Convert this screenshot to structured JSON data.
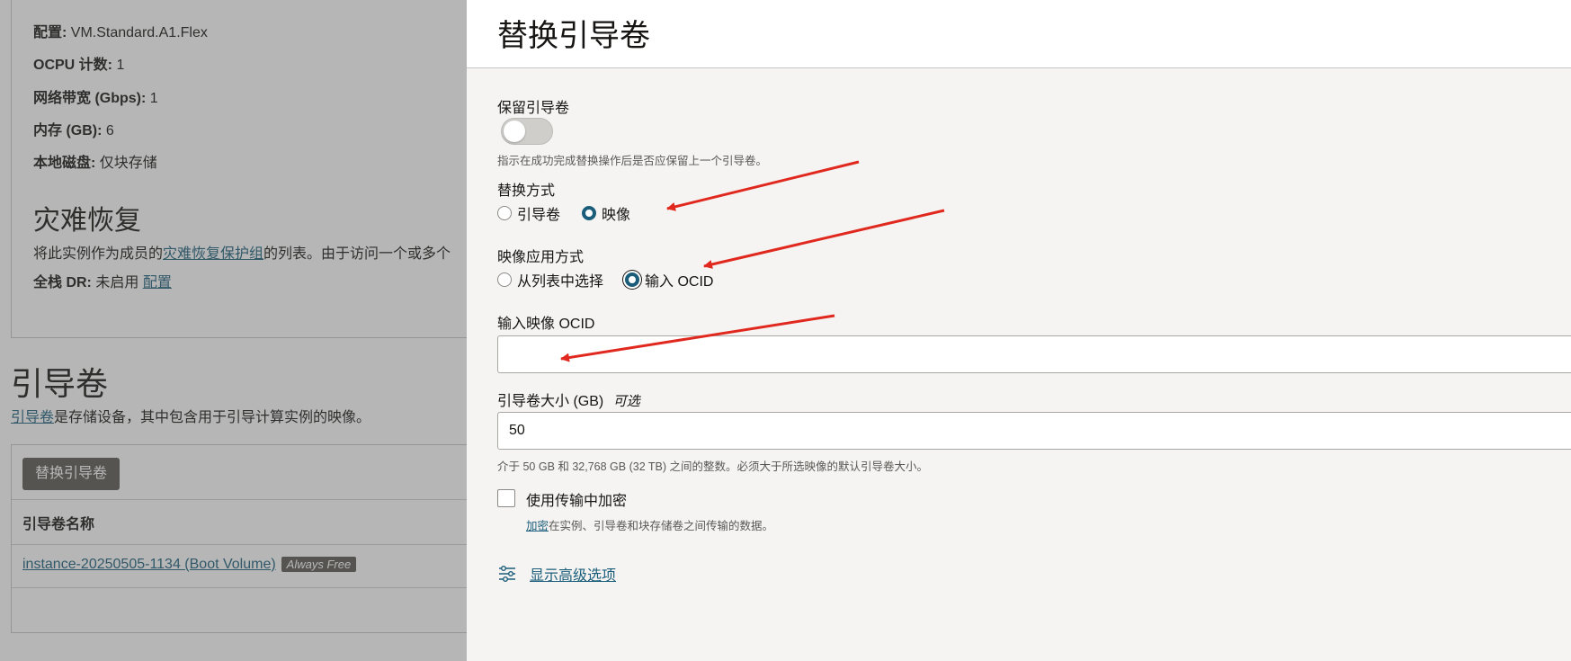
{
  "background": {
    "config_label": "配置:",
    "config_value": "VM.Standard.A1.Flex",
    "ocpu_label": "OCPU 计数:",
    "ocpu_value": "1",
    "bandwidth_label": "网络带宽 (Gbps):",
    "bandwidth_value": "1",
    "memory_label": "内存 (GB):",
    "memory_value": "6",
    "disk_label": "本地磁盘:",
    "disk_value": "仅块存储",
    "dr_title": "灾难恢复",
    "dr_desc_prefix": "将此实例作为成员的",
    "dr_desc_link": "灾难恢复保护组",
    "dr_desc_suffix": "的列表。由于访问一个或多个",
    "fullstack_label": "全栈 DR:",
    "fullstack_value": "未启用",
    "fullstack_link": "配置",
    "bv_title": "引导卷",
    "bv_desc_link": "引导卷",
    "bv_desc_suffix": "是存储设备，其中包含用于引导计算实例的映像。",
    "bv_button": "替换引导卷",
    "bv_col_name": "引导卷名称",
    "bv_row_name": "instance-20250505-1134 (Boot Volume)",
    "bv_row_badge": "Always Free"
  },
  "drawer": {
    "title": "替换引导卷",
    "preserve_label": "保留引导卷",
    "preserve_on": false,
    "preserve_help": "指示在成功完成替换操作后是否应保留上一个引导卷。",
    "replace_by_label": "替换方式",
    "replace_by_options": [
      "引导卷",
      "映像"
    ],
    "replace_by_selected": "映像",
    "image_source_label": "映像应用方式",
    "image_source_options": [
      "从列表中选择",
      "输入 OCID"
    ],
    "image_source_selected": "输入 OCID",
    "ocid_label": "输入映像 OCID",
    "ocid_value": "",
    "size_label": "引导卷大小 (GB)",
    "size_optional": "可选",
    "size_value": "50",
    "size_help": "介于 50 GB 和 32,768 GB (32 TB) 之间的整数。必须大于所选映像的默认引导卷大小。",
    "encrypt_label": "使用传输中加密",
    "encrypt_help_link": "加密",
    "encrypt_help_suffix": "在实例、引导卷和块存储卷之间传输的数据。",
    "advanced_link": "显示高级选项"
  },
  "colors": {
    "accent": "#1a5d7a",
    "annotation_arrow": "#e0281e"
  }
}
